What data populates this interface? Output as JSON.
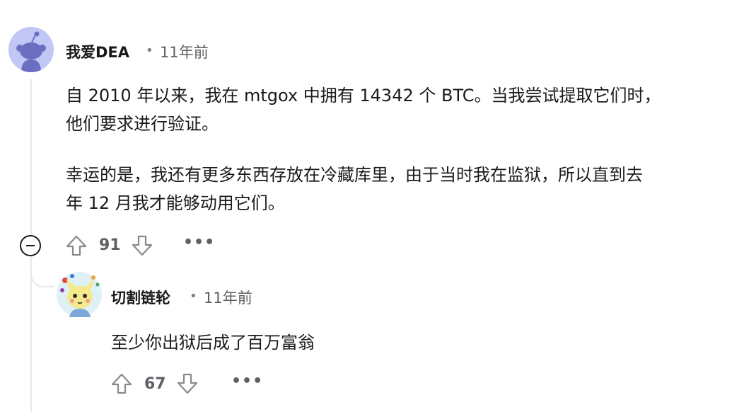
{
  "comment": {
    "author": "我爱DEA",
    "meta_separator": "•",
    "time": "11年前",
    "body_lines": [
      "自 2010 年以来，我在 mtgox 中拥有 14342 个 BTC。当我尝试提取它们时，",
      "他们要求进行验证。",
      "幸运的是，我还有更多东西存放在冷藏库里，由于当时我在监狱，所以直到去",
      "年 12 月我才能够动用它们。"
    ],
    "votes": "91",
    "more_label": "•••",
    "avatar_color": "#c2c8f6"
  },
  "reply": {
    "author": "切割链轮",
    "meta_separator": "•",
    "time": "11年前",
    "body": "至少你出狱后成了百万富翁",
    "votes": "67",
    "more_label": "•••"
  }
}
